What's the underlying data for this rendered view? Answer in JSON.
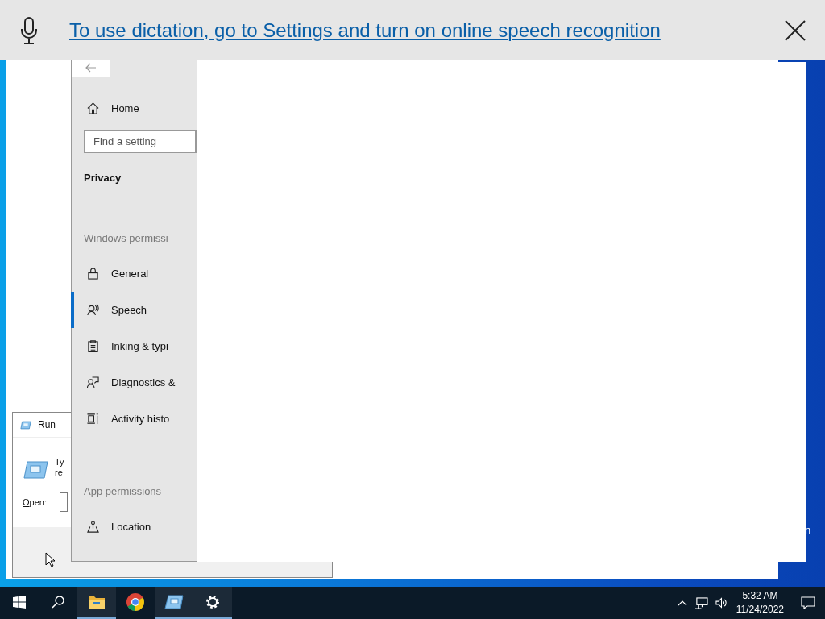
{
  "dictation_bar": {
    "message": "To use dictation, go to Settings and turn on online speech recognition"
  },
  "run_dialog": {
    "title": "Run",
    "description_lines": [
      "Ty",
      "re"
    ],
    "open_label": "Open:"
  },
  "settings": {
    "home": "Home",
    "search": {
      "placeholder": "Find a setting"
    },
    "section_title": "Privacy",
    "groups": [
      {
        "heading": "Windows permissi",
        "items": [
          {
            "label": "General",
            "kind": "lock",
            "selected": false
          },
          {
            "label": "Speech",
            "kind": "speech",
            "selected": true
          },
          {
            "label": "Inking & typi",
            "kind": "clipboard",
            "selected": false
          },
          {
            "label": "Diagnostics &",
            "kind": "feedback",
            "selected": false
          },
          {
            "label": "Activity histo",
            "kind": "activity",
            "selected": false
          }
        ]
      },
      {
        "heading": "App permissions",
        "items": [
          {
            "label": "Location",
            "kind": "location",
            "selected": false
          }
        ]
      }
    ]
  },
  "desktop_text": "n",
  "taskbar": {
    "items": [
      {
        "kind": "start",
        "running": false
      },
      {
        "kind": "search",
        "running": false
      },
      {
        "kind": "explorer",
        "running": true
      },
      {
        "kind": "chrome",
        "running": false
      },
      {
        "kind": "run",
        "running": true
      },
      {
        "kind": "settings",
        "running": true
      }
    ],
    "clock": {
      "time": "5:32 AM",
      "date": "11/24/2022"
    }
  }
}
